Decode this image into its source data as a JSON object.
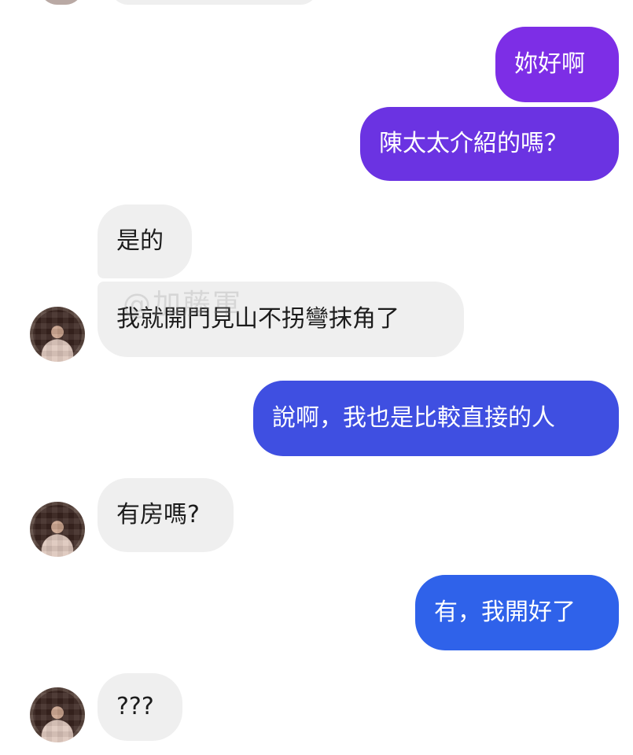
{
  "messages": [
    {
      "side": "out",
      "text": "妳好啊",
      "color": "#7d2ee6"
    },
    {
      "side": "out",
      "text": "陳太太介紹的嗎？",
      "color": "#6b33e2"
    },
    {
      "side": "in",
      "text": "是的"
    },
    {
      "side": "in",
      "text": "我就開門見山不拐彎抹角了"
    },
    {
      "side": "out",
      "text": "說啊，我也是比較直接的人",
      "color": "#3f4fe1"
    },
    {
      "side": "in",
      "text": "有房嗎?"
    },
    {
      "side": "out",
      "text": "有，我開好了",
      "color": "#2f62ea"
    },
    {
      "side": "in",
      "text": "???"
    }
  ],
  "watermark": "@加藤軍"
}
